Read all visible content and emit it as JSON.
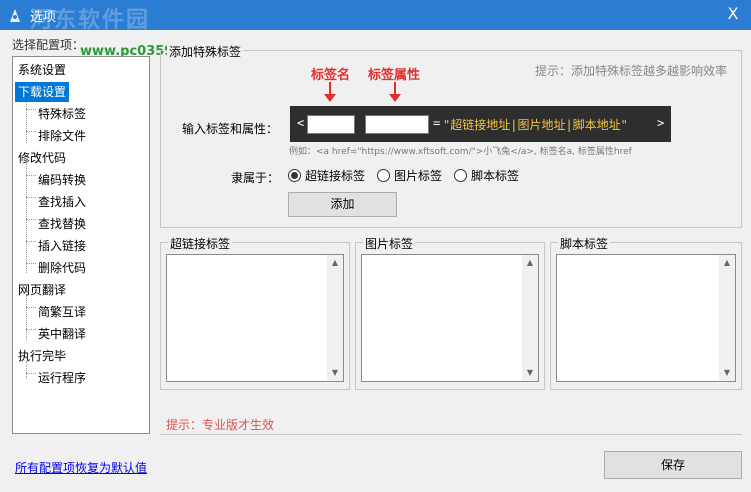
{
  "window": {
    "title": "选项",
    "watermark": "河东软件园",
    "watermark_url": "www.pc0359.cn",
    "close_glyph": "X"
  },
  "sidebar": {
    "label": "选择配置项：",
    "items": [
      {
        "label": "系统设置"
      },
      {
        "label": "下载设置",
        "selected": true
      },
      {
        "label": "特殊标签"
      },
      {
        "label": "排除文件"
      },
      {
        "label": "修改代码"
      },
      {
        "label": "编码转换"
      },
      {
        "label": "查找插入"
      },
      {
        "label": "查找替换"
      },
      {
        "label": "插入链接"
      },
      {
        "label": "删除代码"
      },
      {
        "label": "网页翻译"
      },
      {
        "label": "简繁互译"
      },
      {
        "label": "英中翻译"
      },
      {
        "label": "执行完毕"
      },
      {
        "label": "运行程序"
      }
    ]
  },
  "add_section": {
    "title": "添加特殊标签",
    "hint": "提示：添加特殊标签越多越影响效率",
    "anno_tag_name": "标签名",
    "anno_tag_attr": "标签属性",
    "input_label": "输入标签和属性：",
    "code_open": "<",
    "code_eq": "=",
    "code_value": "\"超链接地址|图片地址|脚本地址\"",
    "code_close": ">",
    "example": "例如：<a href=\"https://www.xftsoft.com/\">小飞兔</a>, 标签名a, 标签属性href",
    "belong_label": "隶属于：",
    "radios": [
      {
        "label": "超链接标签",
        "checked": true
      },
      {
        "label": "图片标签",
        "checked": false
      },
      {
        "label": "脚本标签",
        "checked": false
      }
    ],
    "add_button": "添加"
  },
  "lists": {
    "hyperlink": "超链接标签",
    "image": "图片标签",
    "script": "脚本标签"
  },
  "pro_hint": "提示：专业版才生效",
  "footer": {
    "reset_link": "所有配置项恢复为默认值",
    "save_button": "保存"
  },
  "colors": {
    "titlebar": "#2b7cd3",
    "selected": "#0078d7",
    "annotation": "#e03030"
  }
}
